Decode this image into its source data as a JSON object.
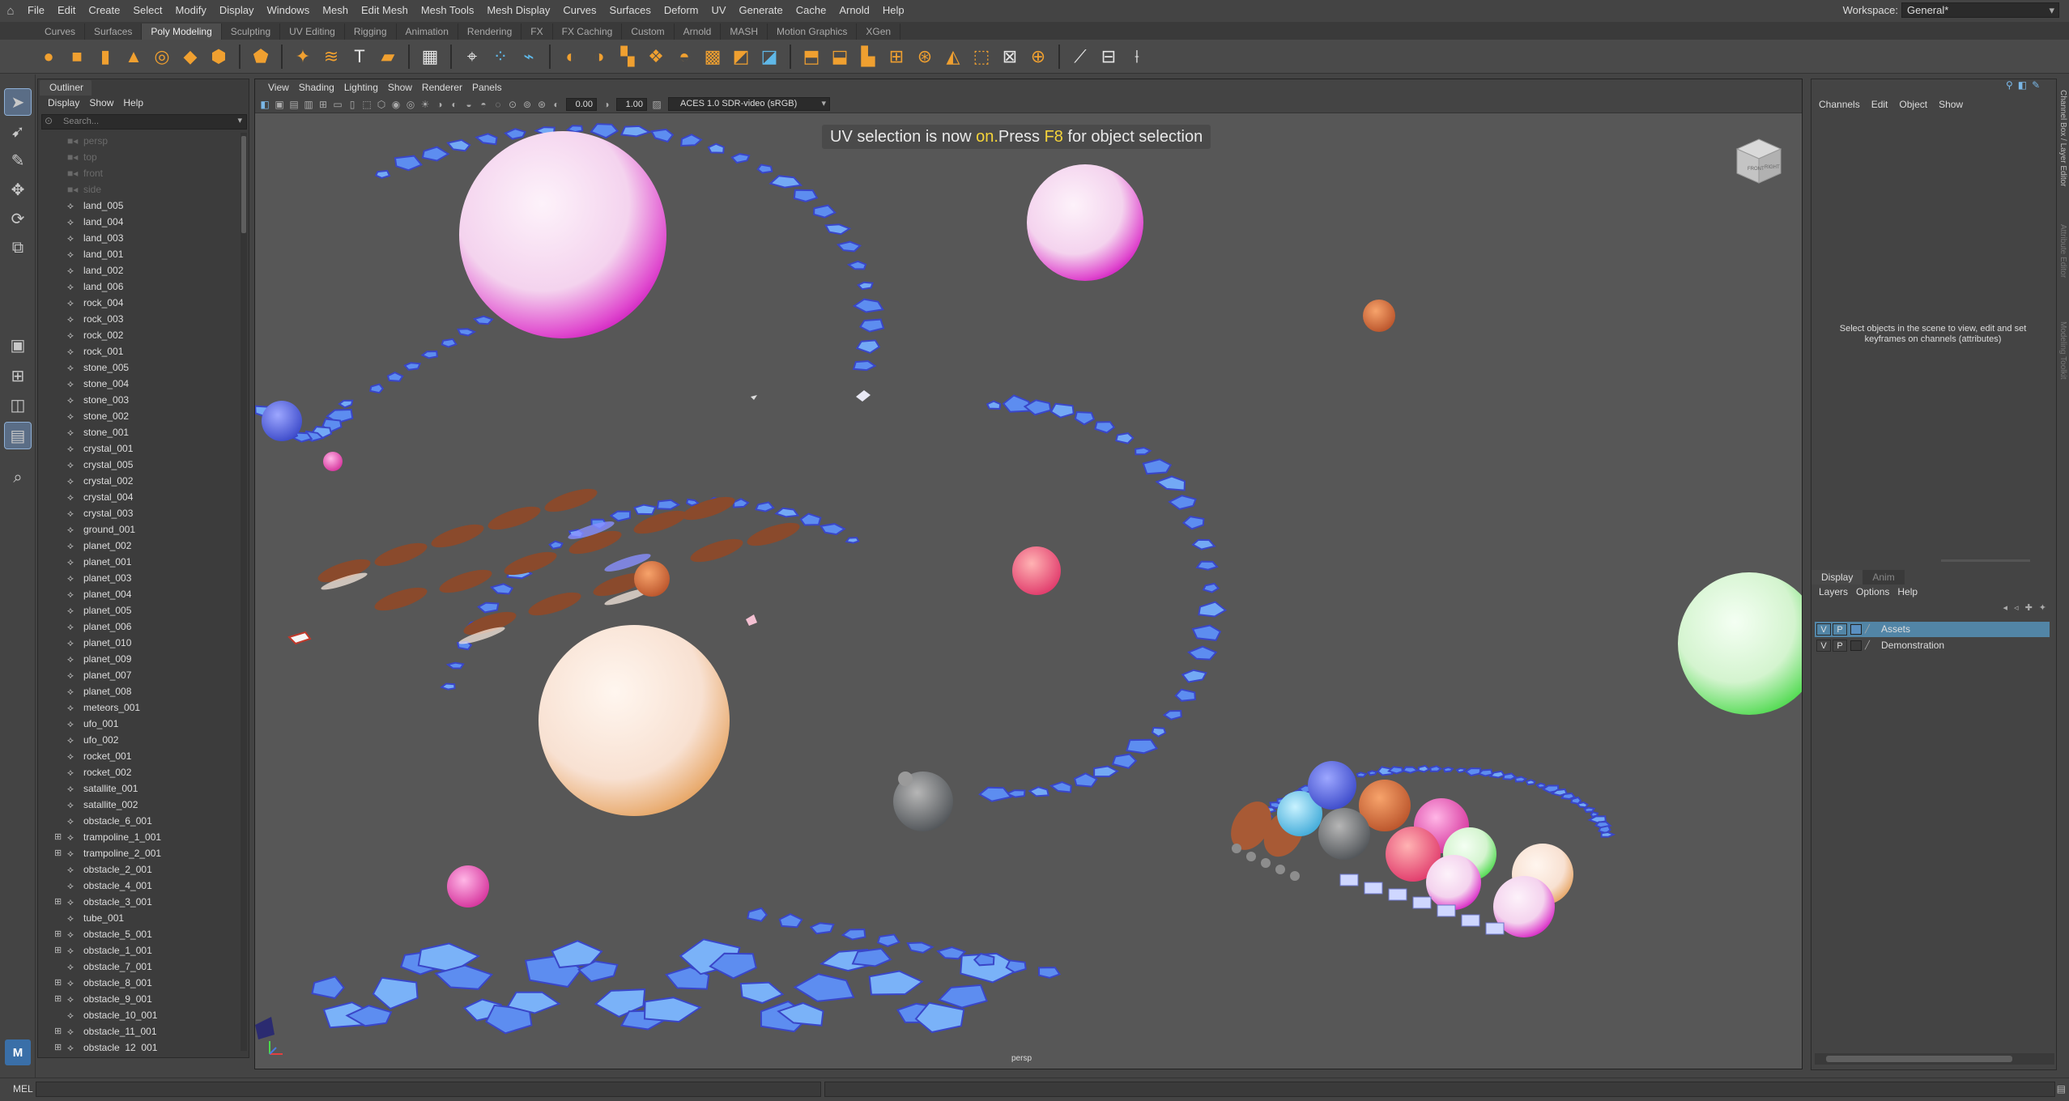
{
  "menubar": {
    "items": [
      "File",
      "Edit",
      "Create",
      "Select",
      "Modify",
      "Display",
      "Windows",
      "Mesh",
      "Edit Mesh",
      "Mesh Tools",
      "Mesh Display",
      "Curves",
      "Surfaces",
      "Deform",
      "UV",
      "Generate",
      "Cache",
      "Arnold",
      "Help"
    ],
    "workspace_label": "Workspace:",
    "workspace_value": "General*"
  },
  "shelf_tabs": [
    "Curves",
    "Surfaces",
    "Poly Modeling",
    "Sculpting",
    "UV Editing",
    "Rigging",
    "Animation",
    "Rendering",
    "FX",
    "FX Caching",
    "Custom",
    "Arnold",
    "MASH",
    "Motion Graphics",
    "XGen"
  ],
  "shelf_active_tab": "Poly Modeling",
  "outliner": {
    "tab": "Outliner",
    "menu": [
      "Display",
      "Show",
      "Help"
    ],
    "search_placeholder": "Search...",
    "items": [
      {
        "name": "persp",
        "type": "camera"
      },
      {
        "name": "top",
        "type": "camera"
      },
      {
        "name": "front",
        "type": "camera"
      },
      {
        "name": "side",
        "type": "camera"
      },
      {
        "name": "land_005",
        "type": "mesh"
      },
      {
        "name": "land_004",
        "type": "mesh"
      },
      {
        "name": "land_003",
        "type": "mesh"
      },
      {
        "name": "land_001",
        "type": "mesh"
      },
      {
        "name": "land_002",
        "type": "mesh"
      },
      {
        "name": "land_006",
        "type": "mesh"
      },
      {
        "name": "rock_004",
        "type": "mesh"
      },
      {
        "name": "rock_003",
        "type": "mesh"
      },
      {
        "name": "rock_002",
        "type": "mesh"
      },
      {
        "name": "rock_001",
        "type": "mesh"
      },
      {
        "name": "stone_005",
        "type": "mesh"
      },
      {
        "name": "stone_004",
        "type": "mesh"
      },
      {
        "name": "stone_003",
        "type": "mesh"
      },
      {
        "name": "stone_002",
        "type": "mesh"
      },
      {
        "name": "stone_001",
        "type": "mesh"
      },
      {
        "name": "crystal_001",
        "type": "mesh"
      },
      {
        "name": "crystal_005",
        "type": "mesh"
      },
      {
        "name": "crystal_002",
        "type": "mesh"
      },
      {
        "name": "crystal_004",
        "type": "mesh"
      },
      {
        "name": "crystal_003",
        "type": "mesh"
      },
      {
        "name": "ground_001",
        "type": "mesh"
      },
      {
        "name": "planet_002",
        "type": "mesh"
      },
      {
        "name": "planet_001",
        "type": "mesh"
      },
      {
        "name": "planet_003",
        "type": "mesh"
      },
      {
        "name": "planet_004",
        "type": "mesh"
      },
      {
        "name": "planet_005",
        "type": "mesh"
      },
      {
        "name": "planet_006",
        "type": "mesh"
      },
      {
        "name": "planet_010",
        "type": "mesh"
      },
      {
        "name": "planet_009",
        "type": "mesh"
      },
      {
        "name": "planet_007",
        "type": "mesh"
      },
      {
        "name": "planet_008",
        "type": "mesh"
      },
      {
        "name": "meteors_001",
        "type": "mesh"
      },
      {
        "name": "ufo_001",
        "type": "mesh"
      },
      {
        "name": "ufo_002",
        "type": "mesh"
      },
      {
        "name": "rocket_001",
        "type": "mesh"
      },
      {
        "name": "rocket_002",
        "type": "mesh"
      },
      {
        "name": "satallite_001",
        "type": "mesh"
      },
      {
        "name": "satallite_002",
        "type": "mesh"
      },
      {
        "name": "obstacle_6_001",
        "type": "mesh"
      },
      {
        "name": "trampoline_1_001",
        "type": "group"
      },
      {
        "name": "trampoline_2_001",
        "type": "group"
      },
      {
        "name": "obstacle_2_001",
        "type": "mesh"
      },
      {
        "name": "obstacle_4_001",
        "type": "mesh"
      },
      {
        "name": "obstacle_3_001",
        "type": "group"
      },
      {
        "name": "tube_001",
        "type": "mesh"
      },
      {
        "name": "obstacle_5_001",
        "type": "group"
      },
      {
        "name": "obstacle_1_001",
        "type": "group"
      },
      {
        "name": "obstacle_7_001",
        "type": "mesh"
      },
      {
        "name": "obstacle_8_001",
        "type": "group"
      },
      {
        "name": "obstacle_9_001",
        "type": "group"
      },
      {
        "name": "obstacle_10_001",
        "type": "mesh"
      },
      {
        "name": "obstacle_11_001",
        "type": "group"
      },
      {
        "name": "obstacle_12_001",
        "type": "group"
      }
    ]
  },
  "viewport": {
    "menu": [
      "View",
      "Shading",
      "Lighting",
      "Show",
      "Renderer",
      "Panels"
    ],
    "field_a": "0.00",
    "field_b": "1.00",
    "colorspace": "ACES 1.0 SDR-video (sRGB)",
    "hud_prefix": "UV selection is now ",
    "hud_on": "on.",
    "hud_mid": "Press ",
    "hud_key": "F8",
    "hud_suffix": " for object selection",
    "camera": "persp",
    "viewcube_front": "FRONT",
    "viewcube_right": "RIGHT"
  },
  "channel_box": {
    "menu": [
      "Channels",
      "Edit",
      "Object",
      "Show"
    ],
    "empty_message": "Select objects in the scene to view, edit and set keyframes on channels (attributes)"
  },
  "layer_editor": {
    "tabs": [
      "Display",
      "Anim"
    ],
    "menu": [
      "Layers",
      "Options",
      "Help"
    ],
    "layers": [
      {
        "v": "V",
        "p": "P",
        "name": "Assets",
        "selected": true,
        "color": "#5285a6"
      },
      {
        "v": "V",
        "p": "P",
        "name": "Demonstration",
        "selected": false,
        "color": "#444444"
      }
    ]
  },
  "side_tabs": [
    "Channel Box / Layer Editor",
    "Attribute Editor",
    "Modeling Toolkit"
  ],
  "command_line": {
    "lang": "MEL"
  }
}
